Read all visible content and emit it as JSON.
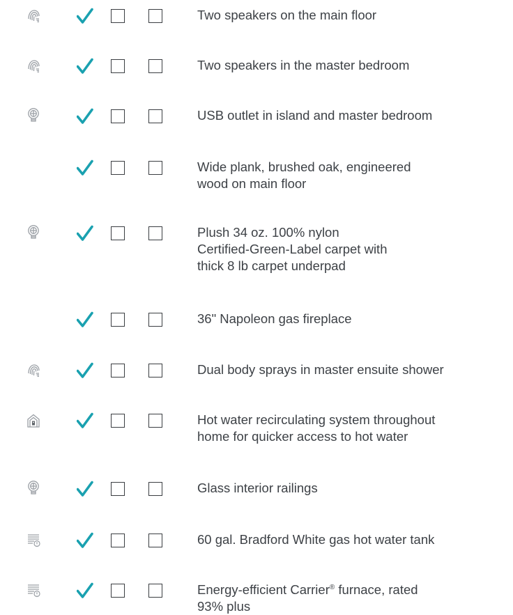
{
  "colors": {
    "check": "#1aa1b0",
    "icon": "#9a9fa5",
    "text": "#3d4146",
    "box": "#3a3d41"
  },
  "rows": [
    {
      "icon": "fingerprint-icon",
      "label": "Two speakers on the main floor",
      "checked": true,
      "option_2": false,
      "option_3": false
    },
    {
      "icon": "fingerprint-icon",
      "label": "Two speakers in the master bedroom",
      "checked": true,
      "option_2": false,
      "option_3": false
    },
    {
      "icon": "lightbulb-icon",
      "label": "USB outlet in island and master bedroom",
      "checked": true,
      "option_2": false,
      "option_3": false
    },
    {
      "icon": "",
      "label": "Wide plank, brushed oak, engineered\nwood on main floor",
      "checked": true,
      "option_2": false,
      "option_3": false
    },
    {
      "icon": "lightbulb-icon",
      "label": "Plush 34 oz. 100% nylon\nCertified-Green-Label carpet with\nthick 8 lb carpet underpad",
      "checked": true,
      "option_2": false,
      "option_3": false
    },
    {
      "icon": "",
      "label": "36\" Napoleon gas fireplace",
      "checked": true,
      "option_2": false,
      "option_3": false
    },
    {
      "icon": "fingerprint-icon",
      "label": "Dual body sprays in master ensuite shower",
      "checked": true,
      "option_2": false,
      "option_3": false
    },
    {
      "icon": "house-icon",
      "label": "Hot water recirculating system throughout\nhome for quicker access to hot water",
      "checked": true,
      "option_2": false,
      "option_3": false
    },
    {
      "icon": "lightbulb-icon",
      "label": "Glass interior railings",
      "checked": true,
      "option_2": false,
      "option_3": false
    },
    {
      "icon": "gauge-icon",
      "label": "60 gal. Bradford White gas hot water tank",
      "checked": true,
      "option_2": false,
      "option_3": false
    },
    {
      "icon": "gauge-icon",
      "label_before": "Energy-efficient Carrier",
      "label_mark": "®",
      "label_after": " furnace, rated\n93% plus",
      "checked": true,
      "option_2": false,
      "option_3": false
    }
  ]
}
